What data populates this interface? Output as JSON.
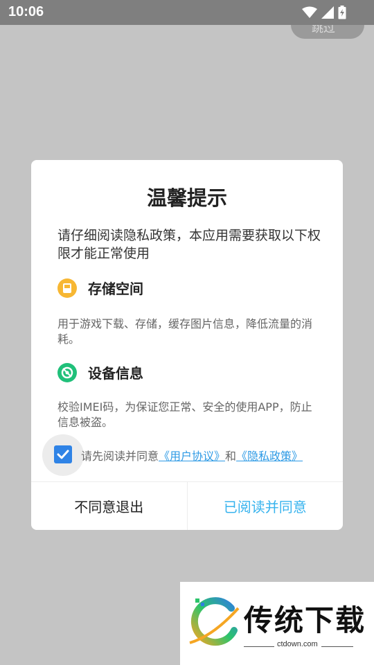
{
  "status_bar": {
    "time": "10:06",
    "icons": [
      "wifi-icon",
      "signal-icon",
      "battery-icon"
    ]
  },
  "background": {
    "skip_label": "跳过"
  },
  "dialog": {
    "title": "温馨提示",
    "intro": "请仔细阅读隐私政策，本应用需要获取以下权限才能正常使用",
    "permissions": [
      {
        "icon": "storage-icon",
        "title": "存储空间",
        "desc": "用于游戏下载、存储，缓存图片信息，降低流量的消耗。",
        "color": "#f7b733"
      },
      {
        "icon": "device-info-icon",
        "title": "设备信息",
        "desc": "校验IMEI码，为保证您正常、安全的使用APP，防止信息被盗。",
        "color": "#20c07a"
      }
    ],
    "agreement": {
      "checked": true,
      "prefix": "请先阅读并同意",
      "user_agreement": "《用户协议》",
      "connector": "和",
      "privacy_policy": "《隐私政策》"
    },
    "buttons": {
      "decline": "不同意退出",
      "accept": "已阅读并同意"
    }
  },
  "watermark": {
    "brand": "传统下载",
    "url": "ctdown.com"
  },
  "colors": {
    "accent": "#37b3ee",
    "link": "#2d9ae5",
    "checkbox": "#2f83e6"
  }
}
